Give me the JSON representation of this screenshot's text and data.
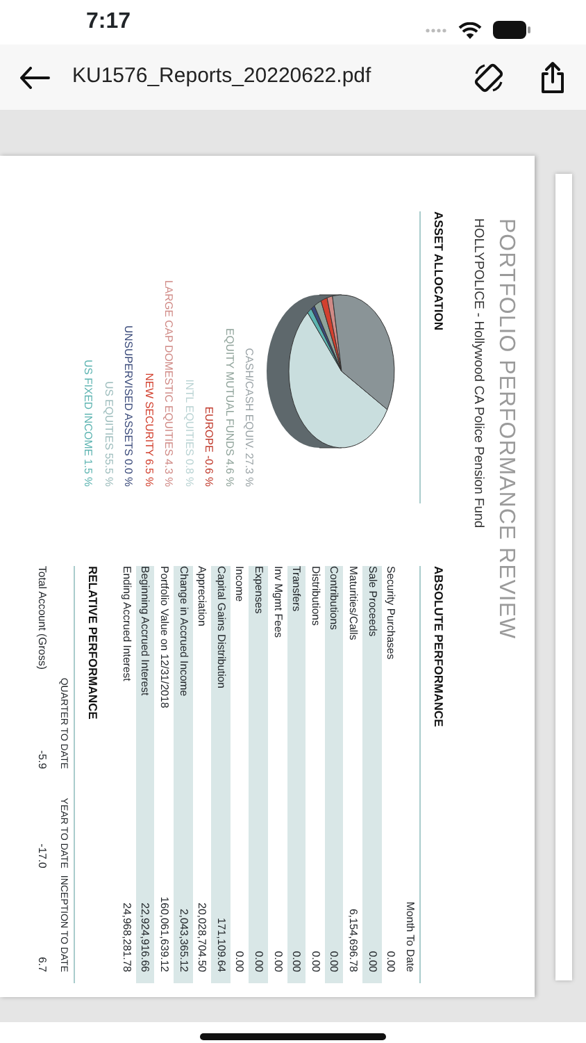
{
  "status_bar": {
    "time": "7:17"
  },
  "toolbar": {
    "title": "KU1576_Reports_20220622.pdf"
  },
  "document": {
    "title": "PORTFOLIO PERFORMANCE REVIEW",
    "subtitle": "HOLLYPOLICE - Hollywood CA Police Pension Fund",
    "asset_allocation": {
      "heading": "ASSET ALLOCATION",
      "legend": [
        {
          "label": "CASH/CASH EQUIV. 27.3 %",
          "color": "#9aa3a6"
        },
        {
          "label": "EQUITY MUTUAL FUNDS 4.6 %",
          "color": "#8fa39a"
        },
        {
          "label": "EUROPE -0.6 %",
          "color": "#c0392b"
        },
        {
          "label": "INTL EQUITIES 0.8 %",
          "color": "#b9d3d3"
        },
        {
          "label": "LARGE CAP DOMESTIC EQUITIES 4.3 %",
          "color": "#d08a86"
        },
        {
          "label": "NEW SECURITY 6.5 %",
          "color": "#d2402e"
        },
        {
          "label": "UNSUPERVISED ASSETS 0.0 %",
          "color": "#3a4a7a"
        },
        {
          "label": "US EQUITIES 55.5 %",
          "color": "#9cbcbc"
        },
        {
          "label": "US FIXED INCOME 1.5 %",
          "color": "#5bb3b0"
        }
      ]
    },
    "absolute_performance": {
      "heading": "ABSOLUTE PERFORMANCE",
      "column": "Month To Date",
      "rows": [
        {
          "label": "Security Purchases",
          "value": "0.00"
        },
        {
          "label": "Sale Proceeds",
          "value": "0.00"
        },
        {
          "label": "Maturities/Calls",
          "value": "6,154,696.78"
        },
        {
          "label": "Contributions",
          "value": "0.00"
        },
        {
          "label": "Distributions",
          "value": "0.00"
        },
        {
          "label": "Transfers",
          "value": "0.00"
        },
        {
          "label": "Inv Mgmt Fees",
          "value": "0.00"
        },
        {
          "label": "Expenses",
          "value": "0.00"
        },
        {
          "label": "Income",
          "value": "0.00"
        },
        {
          "label": "Capital Gains Distribution",
          "value": "171,109.64"
        },
        {
          "label": "Appreciation",
          "value": "20,028,704.50"
        },
        {
          "label": "Change in Accrued Income",
          "value": "2,043,365.12"
        },
        {
          "label": "Portfolio Value on 12/31/2018",
          "value": "160,061,639.12"
        },
        {
          "label": "Beginning Accrued Interest",
          "value": "22,924,916.66"
        },
        {
          "label": "Ending Accrued Interest",
          "value": "24,968,281.78"
        }
      ]
    },
    "relative_performance": {
      "heading": "RELATIVE PERFORMANCE",
      "columns": [
        "QUARTER TO DATE",
        "YEAR TO DATE",
        "INCEPTION TO DATE"
      ],
      "rows": [
        {
          "label": "Total Account (Gross)",
          "values": [
            "-5.9",
            "-17.0",
            "6.7"
          ]
        }
      ]
    }
  }
}
